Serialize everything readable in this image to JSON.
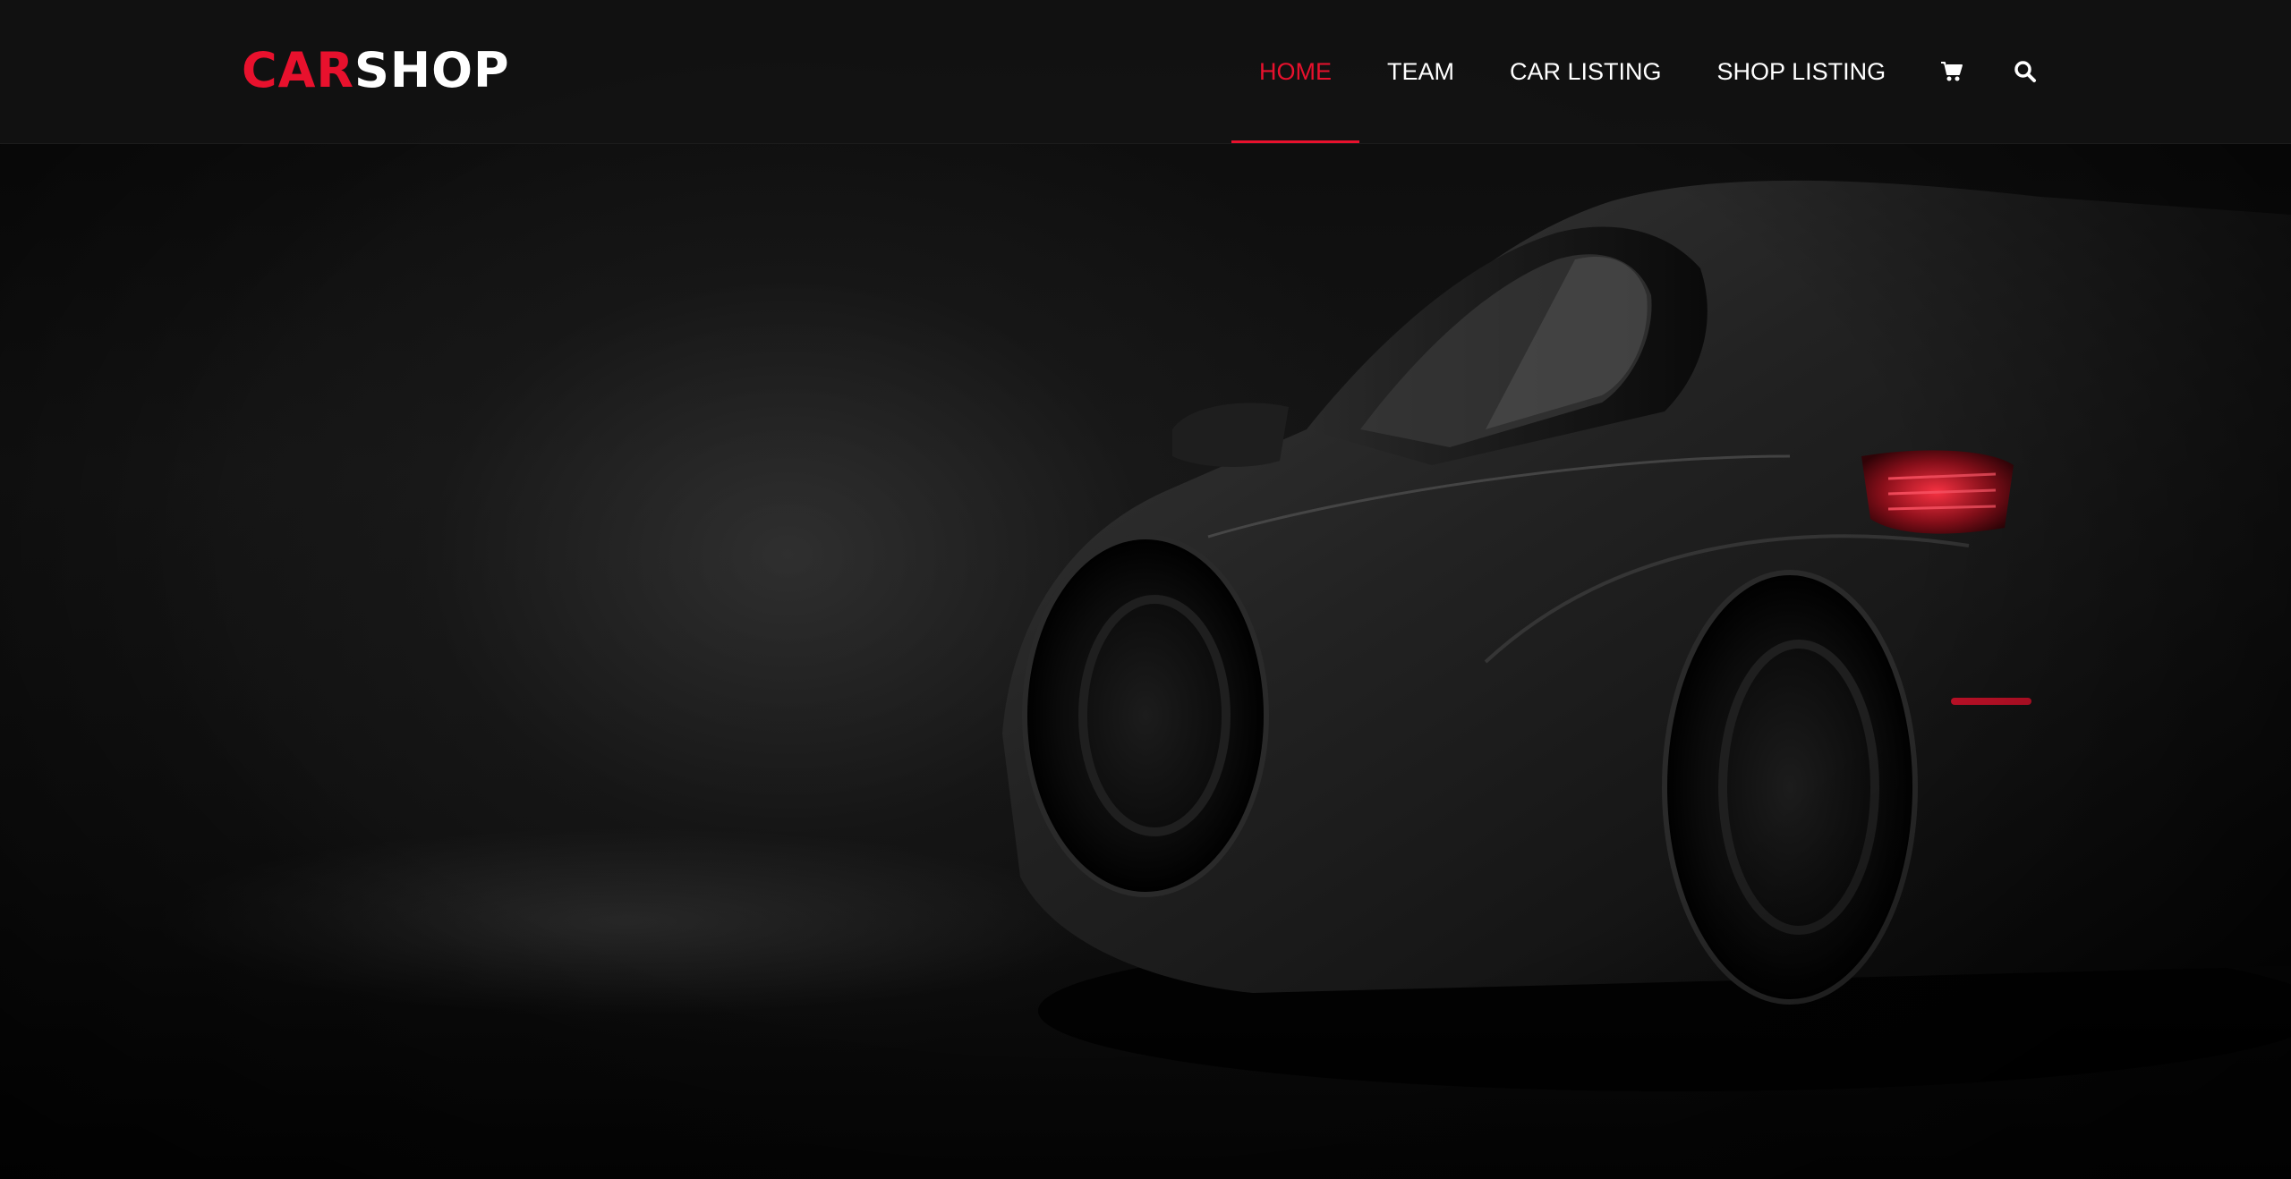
{
  "brand": {
    "logo_part1": "CAR",
    "logo_part2": "SHOP",
    "accent_color": "#e8112d"
  },
  "nav": {
    "items": [
      {
        "label": "HOME",
        "active": true
      },
      {
        "label": "TEAM",
        "active": false
      },
      {
        "label": "CAR LISTING",
        "active": false
      },
      {
        "label": "SHOP LISTING",
        "active": false
      }
    ],
    "icons": [
      "cart-icon",
      "search-icon"
    ]
  },
  "hero": {
    "image": "dark-sports-car-rear-three-quarter-view"
  }
}
